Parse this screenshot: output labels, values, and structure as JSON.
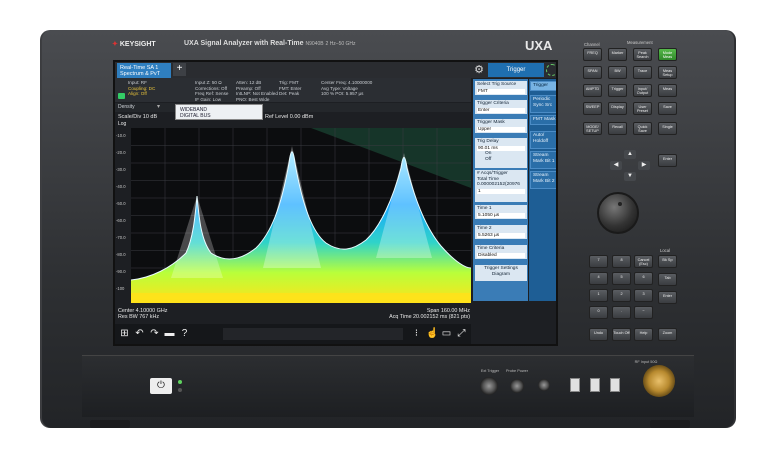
{
  "header": {
    "brand": "KEYSIGHT",
    "model": "UXA Signal Analyzer with Real-Time",
    "model_number": "N9040B",
    "freq_range": "2 Hz–50 GHz",
    "product": "UXA"
  },
  "screen": {
    "tabs": [
      {
        "label_line1": "Real-Time SA 1",
        "label_line2": "Spectrum & PvT"
      }
    ],
    "add_tab": "+",
    "settings_icon": "gear-icon",
    "trigger_tab": "Trigger",
    "infobar": [
      [
        "Input: RF",
        "Coupling: DC",
        "Align: Off"
      ],
      [
        "Input Z: 50 Ω",
        "Corrections: Off",
        "Freq Ref: Sense",
        "IF Gain: Low"
      ],
      [
        "Atten: 12 dB",
        "Preamp: Off",
        "IntLNP: Not Enabled",
        "PNO: Best Wide"
      ],
      [
        "Trig: FMT",
        "FMT: Enter",
        "Det: Peak"
      ],
      [
        "Center Freq: 4.10000000",
        "Avg Type: Voltage",
        "100 % POI: 5.957 µs"
      ]
    ],
    "density_label": "Density",
    "wideband_line1": "WIDEBAND",
    "wideband_line2": "DIGITAL BUS",
    "scale_div": "Scale/Div 10 dB",
    "ref_level": "Ref Level 0.00 dBm",
    "log": "Log",
    "y_ticks": [
      "-10.0",
      "-20.0",
      "-30.0",
      "-40.0",
      "-50.0",
      "-60.0",
      "-70.0",
      "-80.0",
      "-90.0",
      "-100"
    ],
    "center": "Center 4.10000 GHz",
    "res_bw": "Res BW 767 kHz",
    "span": "Span 160.00 MHz",
    "acq_time": "Acq Time 20.002152 ms (821 pts)",
    "softkeys": [
      {
        "label": "Select Trig Source",
        "value": "FMT"
      },
      {
        "label": "Trigger Criteria",
        "value": "Enter"
      },
      {
        "label": "Trigger Mask",
        "value": "Upper"
      },
      {
        "label": "Trig Delay",
        "value": "90.01 ms",
        "extra1": "On",
        "extra2": "Off"
      },
      {
        "label": "# Acqs/Trigger",
        "value": "1",
        "extra1": "Total Time",
        "extra2": "0.000002152(20976"
      },
      {
        "label": "Time 1",
        "value": "5.1050 µs"
      },
      {
        "label": "Time 2",
        "value": "5.5263 µs"
      },
      {
        "label": "Time Criteria",
        "value": "Disabled"
      },
      {
        "label": "Trigger Settings Diagram",
        "value": ""
      }
    ],
    "right_tabs": [
      "Trigger",
      "Periodic Sync Src",
      "FMT Mask",
      "Auto/ Holdoff",
      "Stream Mark Bit 1",
      "Stream Mark Bit 2"
    ]
  },
  "keypad": {
    "group_channel": "Channel",
    "group_measurement": "Measurement",
    "group_local": "Local",
    "keys": [
      "FREQ",
      "Marker",
      "Peak Search",
      "Mode Meas",
      "SPAN",
      "BW",
      "Trace",
      "Meas Setup",
      "AMPTD",
      "Trigger",
      "Input/ Output",
      "Meas",
      "SWEEP",
      "Display",
      "User Preset",
      "Save",
      "MODE/ SETUP",
      "Recall",
      "Quick Save",
      "Single",
      "Cont",
      "Restart",
      "Enter",
      "Cancel (Esc)",
      "Bk Sp",
      "Tab",
      "Undo",
      "Touch Off",
      "Help",
      "Zoom"
    ]
  },
  "front": {
    "ext_trigger": "Ext Trigger",
    "probe_power": "Probe Power",
    "rf_input": "RF Input 50Ω",
    "power_icon": "power-icon"
  },
  "colors": {
    "screen_bg": "#1d1f23",
    "accent": "#3a7cb6",
    "trace_hot": "#ffffff"
  }
}
